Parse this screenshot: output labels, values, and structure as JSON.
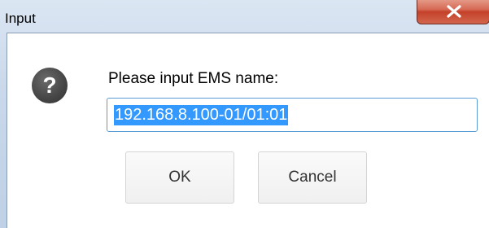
{
  "window": {
    "title": "Input",
    "close_icon": "close-x-icon"
  },
  "dialog": {
    "icon": "question-icon",
    "icon_glyph": "?",
    "prompt": "Please input EMS name:",
    "input_value": "192.168.8.100-01/01:01",
    "input_selected": true
  },
  "buttons": {
    "ok_label": "OK",
    "cancel_label": "Cancel"
  },
  "colors": {
    "selection": "#3399ff",
    "close_button": "#c4412a",
    "title_bar": "#c9d8ea"
  }
}
